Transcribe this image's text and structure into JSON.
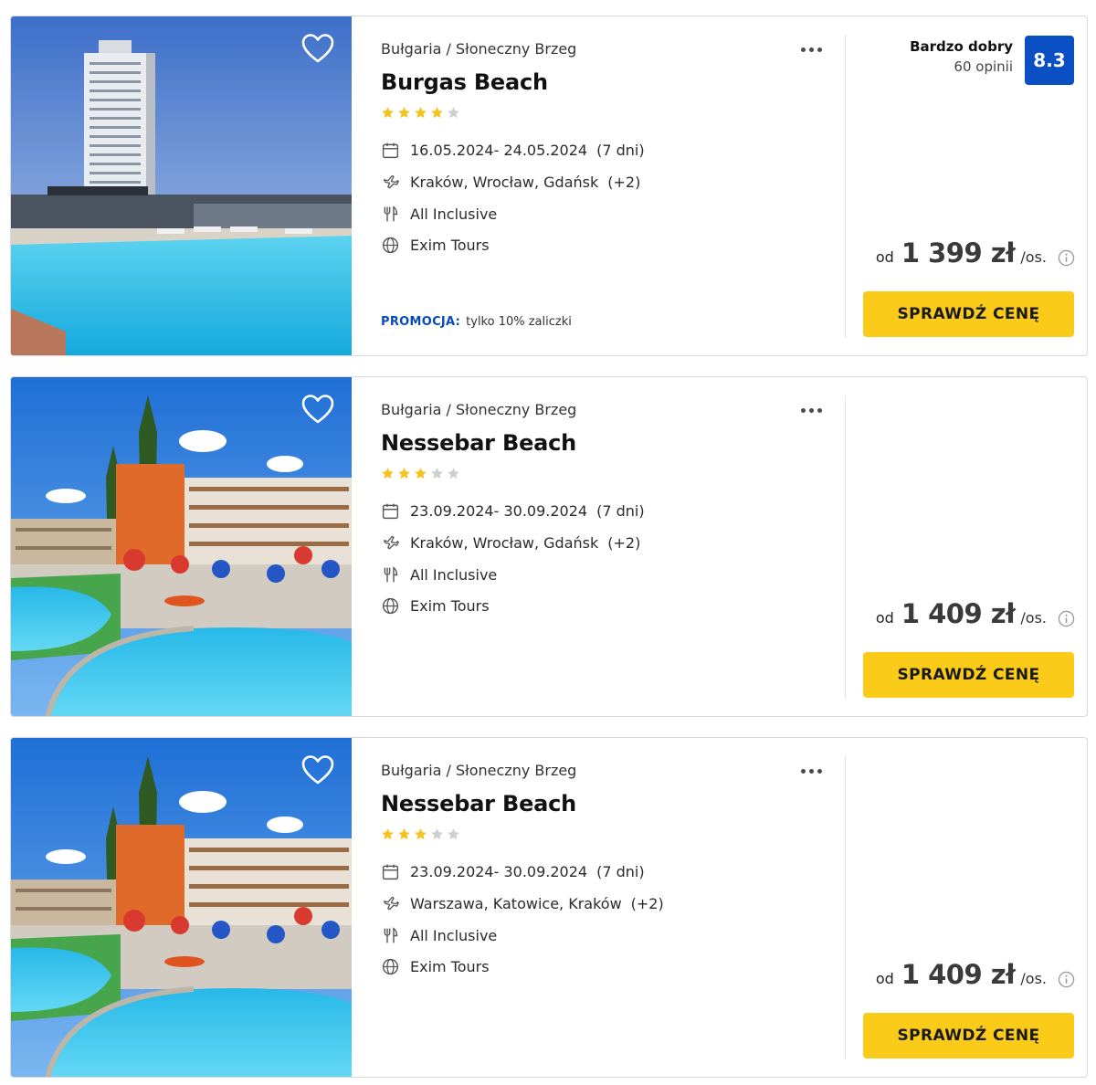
{
  "colors": {
    "accent": "#fbcb1a",
    "rating_badge": "#0b4fc4",
    "promo": "#0a4bb5",
    "star_on": "#f6c31c",
    "star_off": "#cfcfcf"
  },
  "icons": {
    "favorite": "heart-icon",
    "more": "more-dots-icon",
    "dates": "calendar-icon",
    "departure": "plane-icon",
    "board": "cutlery-icon",
    "operator": "globe-icon",
    "price_info": "info-icon"
  },
  "offers": [
    {
      "location": "Bułgaria / Słoneczny Brzeg",
      "name": "Burgas Beach",
      "stars": 4,
      "dates": "16.05.2024- 24.05.2024",
      "duration": "(7 dni)",
      "airports": "Kraków, Wrocław, Gdańsk",
      "airports_more": "(+2)",
      "board": "All Inclusive",
      "operator": "Exim Tours",
      "rating_label": "Bardzo dobry",
      "rating_count": "60 opinii",
      "rating_score": "8.3",
      "promo_label": "PROMOCJA:",
      "promo_text": "tylko 10% zaliczki",
      "price_from": "od",
      "price": "1 399 zł",
      "price_unit": "/os.",
      "cta": "SPRAWDŹ CENĘ"
    },
    {
      "location": "Bułgaria / Słoneczny Brzeg",
      "name": "Nessebar Beach",
      "stars": 3,
      "dates": "23.09.2024- 30.09.2024",
      "duration": "(7 dni)",
      "airports": "Kraków, Wrocław, Gdańsk",
      "airports_more": "(+2)",
      "board": "All Inclusive",
      "operator": "Exim Tours",
      "price_from": "od",
      "price": "1 409 zł",
      "price_unit": "/os.",
      "cta": "SPRAWDŹ CENĘ"
    },
    {
      "location": "Bułgaria / Słoneczny Brzeg",
      "name": "Nessebar Beach",
      "stars": 3,
      "dates": "23.09.2024- 30.09.2024",
      "duration": "(7 dni)",
      "airports": "Warszawa, Katowice, Kraków",
      "airports_more": "(+2)",
      "board": "All Inclusive",
      "operator": "Exim Tours",
      "price_from": "od",
      "price": "1 409 zł",
      "price_unit": "/os.",
      "cta": "SPRAWDŹ CENĘ"
    }
  ]
}
